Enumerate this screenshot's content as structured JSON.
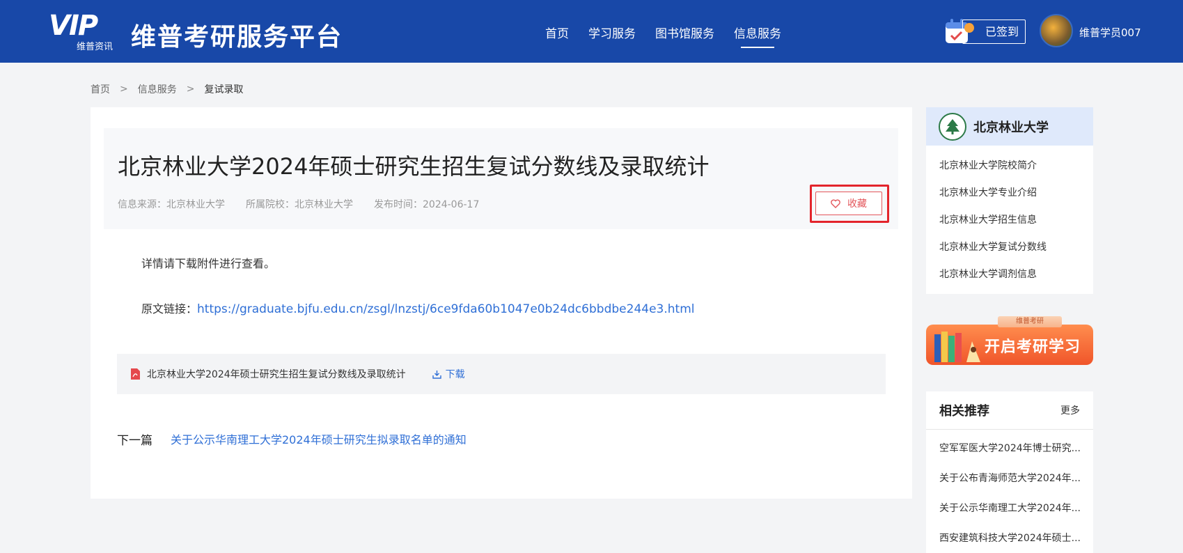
{
  "header": {
    "logo_text": "VIP",
    "logo_sub": "维普资讯",
    "site_title": "维普考研服务平台",
    "nav": [
      "首页",
      "学习服务",
      "图书馆服务",
      "信息服务"
    ],
    "active_nav": "信息服务",
    "signin_label": "已签到",
    "username": "维普学员007"
  },
  "breadcrumb": [
    "首页",
    "信息服务",
    "复试录取"
  ],
  "breadcrumb_sep": ">",
  "article": {
    "title": "北京林业大学2024年硕士研究生招生复试分数线及录取统计",
    "source": "信息来源：北京林业大学",
    "school": "所属院校：北京林业大学",
    "date": "发布时间：2024-06-17",
    "favorite_label": "收藏",
    "body": "详情请下载附件进行查看。",
    "link_label": "原文链接：",
    "link_url": "https://graduate.bjfu.edu.cn/zsgl/lnzstj/6ce9fda60b1047e0b24dc6bbdbe244e3.html",
    "attachment_name": "北京林业大学2024年硕士研究生招生复试分数线及录取统计",
    "download_label": "下载",
    "next_label": "下一篇",
    "next_title": "关于公示华南理工大学2024年硕士研究生拟录取名单的通知"
  },
  "sidebar": {
    "university": "北京林业大学",
    "links": [
      "北京林业大学院校简介",
      "北京林业大学专业介绍",
      "北京林业大学招生信息",
      "北京林业大学复试分数线",
      "北京林业大学调剂信息"
    ],
    "banner_tag": "维普考研",
    "banner_text": "开启考研学习",
    "rec_title": "相关推荐",
    "rec_more": "更多",
    "rec_items": [
      "空军军医大学2024年博士研究...",
      "关于公布青海师范大学2024年...",
      "关于公示华南理工大学2024年...",
      "西安建筑科技大学2024年硕士..."
    ]
  },
  "colors": {
    "header_bg": "#1848a8",
    "link": "#2f6fd6",
    "favorite": "#e3565b",
    "highlight_box": "#e3242b"
  }
}
